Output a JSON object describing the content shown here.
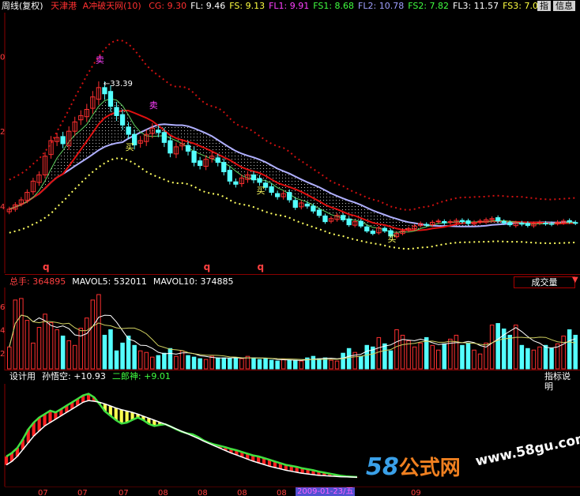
{
  "header": {
    "chart_type": "周线(复权)",
    "stock_name": "天津港",
    "indicator_name": "A冲破天网(10)",
    "values": [
      {
        "label": "CG:",
        "value": "9.30",
        "color": "#ff3030"
      },
      {
        "label": "FL:",
        "value": "9.46",
        "color": "#ffffff"
      },
      {
        "label": "FS:",
        "value": "9.13",
        "color": "#ffff40"
      },
      {
        "label": "FL1:",
        "value": "9.91",
        "color": "#ff40ff"
      },
      {
        "label": "FS1:",
        "value": "8.68",
        "color": "#40ff40"
      },
      {
        "label": "FL2:",
        "value": "10.78",
        "color": "#a0a0ff"
      },
      {
        "label": "FS2:",
        "value": "7.82",
        "color": "#40ff40"
      },
      {
        "label": "FL3:",
        "value": "11.57",
        "color": "#ffffff"
      },
      {
        "label": "FS3:",
        "value": "7.0",
        "color": "#ffff40"
      }
    ],
    "btn_zhi": "指",
    "btn_info": "信息"
  },
  "price_panel": {
    "peak_label": "33.39",
    "sell_marks": [
      "卖",
      "卖"
    ],
    "buy_marks": [
      "买",
      "买",
      "买"
    ],
    "q_marks": [
      "q",
      "q",
      "q"
    ],
    "y_tick_fragments": [
      "0",
      "2",
      "4"
    ]
  },
  "volume_panel": {
    "header": [
      {
        "label": "总手:",
        "value": "364895",
        "color": "#ff4040"
      },
      {
        "label": "MAVOL5:",
        "value": "532011",
        "color": "#ffffff"
      },
      {
        "label": "MAVOL10:",
        "value": "374885",
        "color": "#ffffff"
      }
    ],
    "name_button": "成交量",
    "y_tick_fragments": [
      "6",
      "4",
      "2"
    ]
  },
  "indicator_panel": {
    "header_parts": [
      {
        "text": "设计用",
        "color": "#ffffff"
      },
      {
        "text": "孙悟空: +10.93",
        "color": "#ffffff"
      },
      {
        "text": "二郎神: +9.01",
        "color": "#40ff40"
      }
    ],
    "help_button": "指标说明"
  },
  "x_axis": {
    "labels": [
      "07",
      "07",
      "07",
      "08",
      "08",
      "08",
      "08",
      "09",
      "09"
    ],
    "highlight_date": "2009-01-23/五"
  },
  "watermark": {
    "logo_digits": "58",
    "logo_text": "公式网",
    "url": "www.58gu.com"
  },
  "chart_data": [
    {
      "type": "candlestick",
      "name": "price",
      "peak_label": 33.39,
      "upper_band_ratio": 1.35,
      "lower_band_ratio": 0.72,
      "close": [
        13.5,
        14.2,
        15.0,
        16.2,
        18.0,
        19.0,
        22.0,
        24.5,
        25.0,
        24.0,
        26.0,
        27.5,
        28.5,
        29.5,
        31.5,
        33.0,
        32.0,
        30.0,
        28.5,
        27.0,
        25.5,
        23.8,
        24.5,
        25.5,
        26.5,
        25.8,
        24.2,
        22.5,
        23.5,
        24.0,
        22.8,
        21.0,
        20.5,
        21.5,
        22.0,
        21.0,
        19.5,
        18.0,
        17.5,
        18.5,
        19.0,
        18.2,
        17.8,
        17.0,
        16.2,
        15.5,
        16.0,
        15.0,
        13.8,
        14.5,
        14.0,
        13.2,
        12.5,
        11.5,
        12.0,
        12.5,
        11.8,
        11.0,
        11.5,
        10.8,
        10.0,
        9.6,
        10.5,
        10.0,
        9.2,
        9.6,
        10.0,
        10.4,
        10.8,
        11.2,
        11.0,
        11.4,
        11.6,
        11.3,
        11.5,
        11.7,
        11.5,
        11.2,
        11.4,
        11.6,
        11.8,
        12.0,
        11.6,
        11.3,
        11.0,
        11.3,
        11.1,
        10.9,
        11.2,
        11.4,
        11.2,
        11.1,
        11.4,
        11.6,
        11.5,
        11.3
      ]
    },
    {
      "type": "bar",
      "name": "volume",
      "mavol5": 532011,
      "mavol10": 374885,
      "last_volume": 364895,
      "values": [
        280000,
        880000,
        900000,
        620000,
        330000,
        530000,
        700000,
        590000,
        500000,
        420000,
        360000,
        300000,
        520000,
        650000,
        880000,
        950000,
        430000,
        500000,
        230000,
        330000,
        420000,
        300000,
        230000,
        210000,
        150000,
        170000,
        200000,
        260000,
        160000,
        230000,
        170000,
        150000,
        130000,
        120000,
        160000,
        140000,
        140000,
        130000,
        140000,
        130000,
        160000,
        140000,
        120000,
        130000,
        110000,
        100000,
        120000,
        110000,
        110000,
        100000,
        140000,
        160000,
        130000,
        140000,
        110000,
        100000,
        200000,
        260000,
        210000,
        160000,
        300000,
        280000,
        400000,
        320000,
        230000,
        500000,
        430000,
        360000,
        280000,
        330000,
        400000,
        300000,
        240000,
        320000,
        380000,
        430000,
        300000,
        330000,
        240000,
        190000,
        330000,
        560000,
        580000,
        510000,
        430000,
        560000,
        300000,
        260000,
        240000,
        280000,
        300000,
        260000,
        320000,
        420000,
        500000,
        430000
      ]
    },
    {
      "type": "area",
      "name": "indicator",
      "series": [
        {
          "name": "孙悟空",
          "last": 10.93
        },
        {
          "name": "二郎神",
          "last": 9.01
        }
      ],
      "upper": [
        14.5,
        15.5,
        17.0,
        19.5,
        22.5,
        24.5,
        26.0,
        27.0,
        28.0,
        27.5,
        28.5,
        29.5,
        30.5,
        31.5,
        32.5,
        33.0,
        32.0,
        30.0,
        27.8,
        26.5,
        25.2,
        24.2,
        24.5,
        25.3,
        26.0,
        25.2,
        24.1,
        23.5,
        23.8,
        24.0,
        23.3,
        22.5,
        21.8,
        21.3,
        21.0,
        20.2,
        19.2,
        18.5,
        18.0,
        17.6,
        17.2,
        16.7,
        16.3,
        15.8,
        15.3,
        14.8,
        14.5,
        14.0,
        13.5,
        13.0,
        12.5,
        12.0,
        11.7,
        11.4,
        11.0,
        10.7,
        10.4,
        10.0,
        9.7,
        9.4,
        9.1,
        8.8,
        8.6,
        8.5,
        8.4
      ],
      "lower": [
        12.0,
        13.0,
        14.5,
        16.5,
        18.5,
        20.5,
        22.0,
        23.5,
        24.5,
        25.5,
        26.5,
        27.5,
        28.5,
        29.5,
        30.5,
        31.0,
        30.8,
        30.5,
        30.0,
        29.4,
        28.8,
        28.3,
        27.9,
        27.5,
        27.0,
        26.4,
        25.8,
        25.2,
        24.6,
        24.0,
        23.3,
        22.6,
        21.9,
        21.2,
        20.5,
        19.8,
        19.0,
        18.3,
        17.6,
        16.9,
        16.2,
        15.5,
        14.9,
        14.3,
        13.7,
        13.1,
        12.6,
        12.1,
        11.6,
        11.2,
        10.8,
        10.4,
        10.1,
        9.8,
        9.5,
        9.3,
        9.1,
        8.9,
        8.8,
        8.7,
        8.6,
        8.5,
        8.45,
        8.4,
        8.35
      ]
    }
  ]
}
